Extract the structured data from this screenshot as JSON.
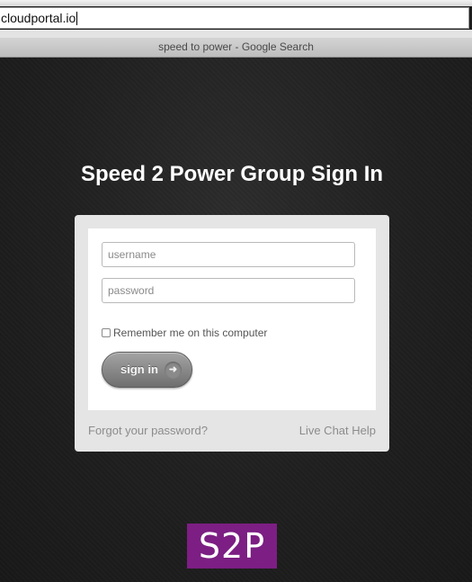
{
  "browser": {
    "url": "cloudportal.io",
    "window_title": "speed to power - Google Search"
  },
  "page": {
    "heading": "Speed 2 Power Group Sign In",
    "username_placeholder": "username",
    "password_placeholder": "password",
    "remember_label": "Remember me on this computer",
    "remember_checked": false,
    "signin_label": "sign in",
    "signin_icon": "arrow-right-icon",
    "forgot_label": "Forgot your password?",
    "chat_label": "Live Chat Help",
    "logo_text": "S2P",
    "colors": {
      "background": "#1e1e1e",
      "card": "#e5e5e5",
      "logo_bg": "#7c1e83"
    }
  }
}
